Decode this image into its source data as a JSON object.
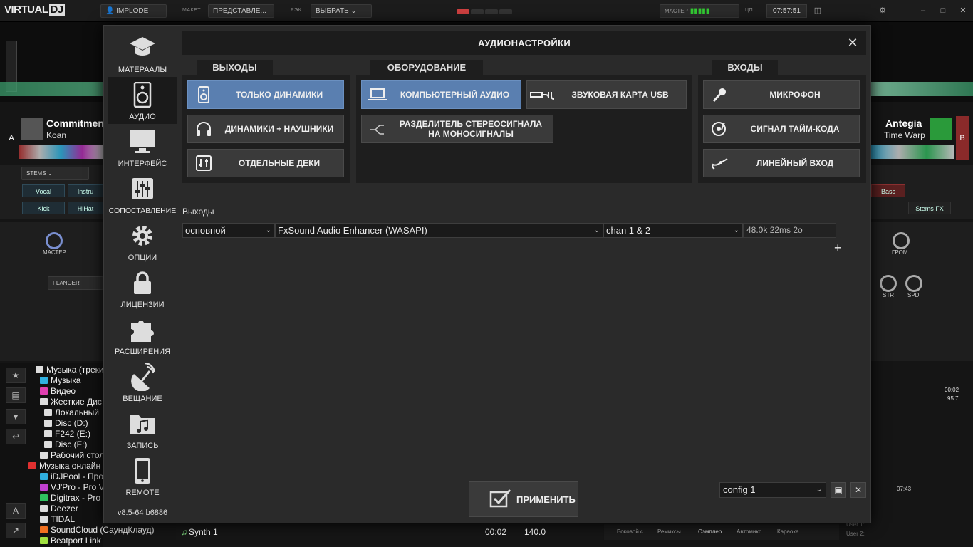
{
  "topbar": {
    "logo": "VIRTUAL",
    "logo_box": "DJ",
    "deck_name": "IMPLODE",
    "layout_label": "МАКЕТ",
    "layout_value": "ПРЕДСТАВЛЕ...",
    "mode_label": "РЭК",
    "mode_value": "ВЫБРАТЬ",
    "master_label": "МАСТЕР",
    "cpu_label": "ЦП",
    "clock": "07:57:51"
  },
  "deck_a": {
    "side": "A",
    "title": "Commitment",
    "artist": "Koan",
    "stems": "STEMS",
    "stem_buttons": [
      "Vocal",
      "Instru",
      "Kick",
      "HiHat"
    ],
    "fx": "FLANGER",
    "master_knob": "МАСТЕР"
  },
  "deck_b": {
    "side": "B",
    "title": "Antegia",
    "artist": "Time Warp",
    "stem_buttons": [
      "Bass",
      "Stems FX"
    ],
    "knob": "ГРОМ",
    "str": "STR",
    "spd": "SPD"
  },
  "browser": {
    "items": [
      {
        "label": "Музыка (треки) на",
        "color": "#ddd"
      },
      {
        "label": "Музыка",
        "color": "#2fb0e0"
      },
      {
        "label": "Видео",
        "color": "#e03fb0"
      },
      {
        "label": "Жесткие Дис",
        "color": "#ddd"
      },
      {
        "label": "Локальный",
        "color": "#ddd"
      },
      {
        "label": "Disc (D:)",
        "color": "#ddd"
      },
      {
        "label": "F242 (E:)",
        "color": "#ddd"
      },
      {
        "label": "Disc (F:)",
        "color": "#ddd"
      },
      {
        "label": "Рабочий стол",
        "color": "#ddd"
      },
      {
        "label": "Музыка онлайн",
        "color": "#e03030"
      },
      {
        "label": "iDJPool - Професси",
        "color": "#2fb0e0"
      },
      {
        "label": "VJ'Pro - Pro V",
        "color": "#c040d0"
      },
      {
        "label": "Digitrax - Pro",
        "color": "#30c060"
      },
      {
        "label": "Deezer",
        "color": "#ddd"
      },
      {
        "label": "TIDAL",
        "color": "#ddd"
      },
      {
        "label": "SoundCloud (СаундКлауд)",
        "color": "#f07020"
      },
      {
        "label": "Beatport Link",
        "color": "#a0e040"
      }
    ]
  },
  "bottom": {
    "track": "Synth 1",
    "time": "00:02",
    "bpm": "140.0",
    "tabs": [
      "Боковой с",
      "Ремиксы",
      "Сэмплер",
      "Автомикс",
      "Караоке"
    ]
  },
  "right_info": {
    "time": "00:02",
    "bpm": "95.7",
    "view_time": "07:43",
    "user1": "User 1:",
    "user2": "User 2:"
  },
  "dialog": {
    "title": "АУДИОНАСТРОЙКИ",
    "nav": [
      {
        "label": "МАТЕРААЛЫ",
        "icon": "graduation-cap-icon"
      },
      {
        "label": "АУДИО",
        "icon": "speaker-icon"
      },
      {
        "label": "ИНТЕРФЕЙС",
        "icon": "monitor-icon"
      },
      {
        "label": "СОПОСТАВЛЕНИЕ",
        "icon": "sliders-icon"
      },
      {
        "label": "ОПЦИИ",
        "icon": "gear-icon"
      },
      {
        "label": "ЛИЦЕНЗИИ",
        "icon": "lock-icon"
      },
      {
        "label": "РАСШИРЕНИЯ",
        "icon": "puzzle-icon"
      },
      {
        "label": "ВЕЩАНИЕ",
        "icon": "satellite-icon"
      },
      {
        "label": "ЗАПИСЬ",
        "icon": "music-folder-icon"
      },
      {
        "label": "REMOTE",
        "icon": "phone-icon"
      }
    ],
    "version": "v8.5-64 b6886",
    "groups": {
      "outputs": {
        "tab": "ВЫХОДЫ",
        "buttons": [
          "ТОЛЬКО ДИНАМИКИ",
          "ДИНАМИКИ + НАУШНИКИ",
          "ОТДЕЛЬНЫЕ ДЕКИ"
        ]
      },
      "hardware": {
        "tab": "ОБОРУДОВАНИЕ",
        "buttons": [
          "КОМПЬЮТЕРНЫЙ АУДИО",
          "ЗВУКОВАЯ КАРТА USB",
          "РАЗДЕЛИТЕЛЬ СТЕРЕОСИГНАЛА НА МОНОСИГНАЛЫ"
        ]
      },
      "inputs": {
        "tab": "ВХОДЫ",
        "buttons": [
          "МИКРОФОН",
          "СИГНАЛ ТАЙМ-КОДА",
          "ЛИНЕЙНЫЙ ВХОД"
        ]
      }
    },
    "outputs_label": "Выходы",
    "row": {
      "type": "основной",
      "device": "FxSound Audio Enhancer (WASAPI)",
      "channels": "chan 1 & 2",
      "info": "48.0k 22ms 2o"
    },
    "plus": "+",
    "apply": "ПРИМЕНИТЬ",
    "config": "config 1"
  },
  "colors": {
    "accent": "#5a7fb0",
    "bg": "#2a2a2a"
  }
}
